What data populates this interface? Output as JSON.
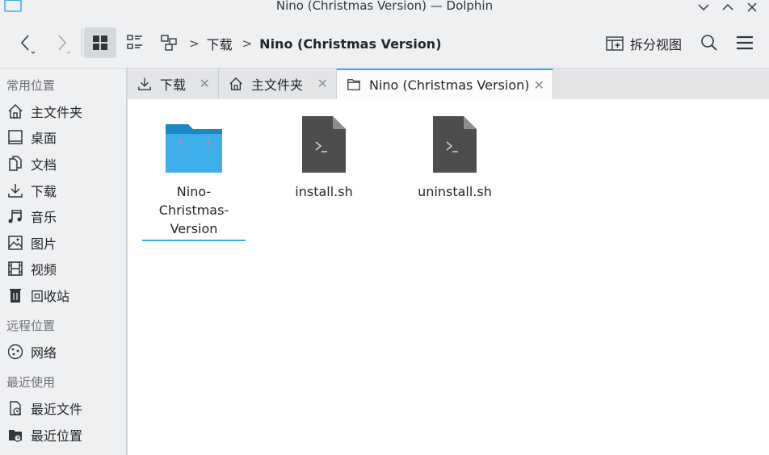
{
  "window": {
    "title": "Nino (Christmas Version) — Dolphin"
  },
  "toolbar": {
    "back_icon": "chevron-left",
    "forward_icon": "chevron-right",
    "view_modes": [
      "icons",
      "details",
      "tree"
    ],
    "breadcrumb": [
      "下载",
      "Nino (Christmas Version)"
    ],
    "split_label": "拆分视图"
  },
  "sidebar": {
    "sections": [
      {
        "title": "常用位置",
        "items": [
          {
            "label": "主文件夹",
            "icon": "home-icon"
          },
          {
            "label": "桌面",
            "icon": "desktop-icon"
          },
          {
            "label": "文档",
            "icon": "documents-icon"
          },
          {
            "label": "下载",
            "icon": "download-icon"
          },
          {
            "label": "音乐",
            "icon": "music-icon"
          },
          {
            "label": "图片",
            "icon": "pictures-icon"
          },
          {
            "label": "视频",
            "icon": "videos-icon"
          },
          {
            "label": "回收站",
            "icon": "trash-icon"
          }
        ]
      },
      {
        "title": "远程位置",
        "items": [
          {
            "label": "网络",
            "icon": "network-icon"
          }
        ]
      },
      {
        "title": "最近使用",
        "items": [
          {
            "label": "最近文件",
            "icon": "recent-files-icon"
          },
          {
            "label": "最近位置",
            "icon": "recent-locations-icon"
          }
        ]
      }
    ]
  },
  "tabs": [
    {
      "label": "下载",
      "icon": "download-icon"
    },
    {
      "label": "主文件夹",
      "icon": "home-icon"
    },
    {
      "label": "Nino (Christmas Version)",
      "icon": "folder-icon"
    }
  ],
  "files": [
    {
      "name": "Nino-Christmas-Version",
      "line1": "Nino-Christmas-",
      "line2": "Version",
      "type": "folder",
      "selected": true
    },
    {
      "name": "install.sh",
      "type": "script"
    },
    {
      "name": "uninstall.sh",
      "type": "script"
    }
  ],
  "colors": {
    "accent": "#3daee9",
    "folder": "#3daee9",
    "script": "#4d4d4d"
  }
}
